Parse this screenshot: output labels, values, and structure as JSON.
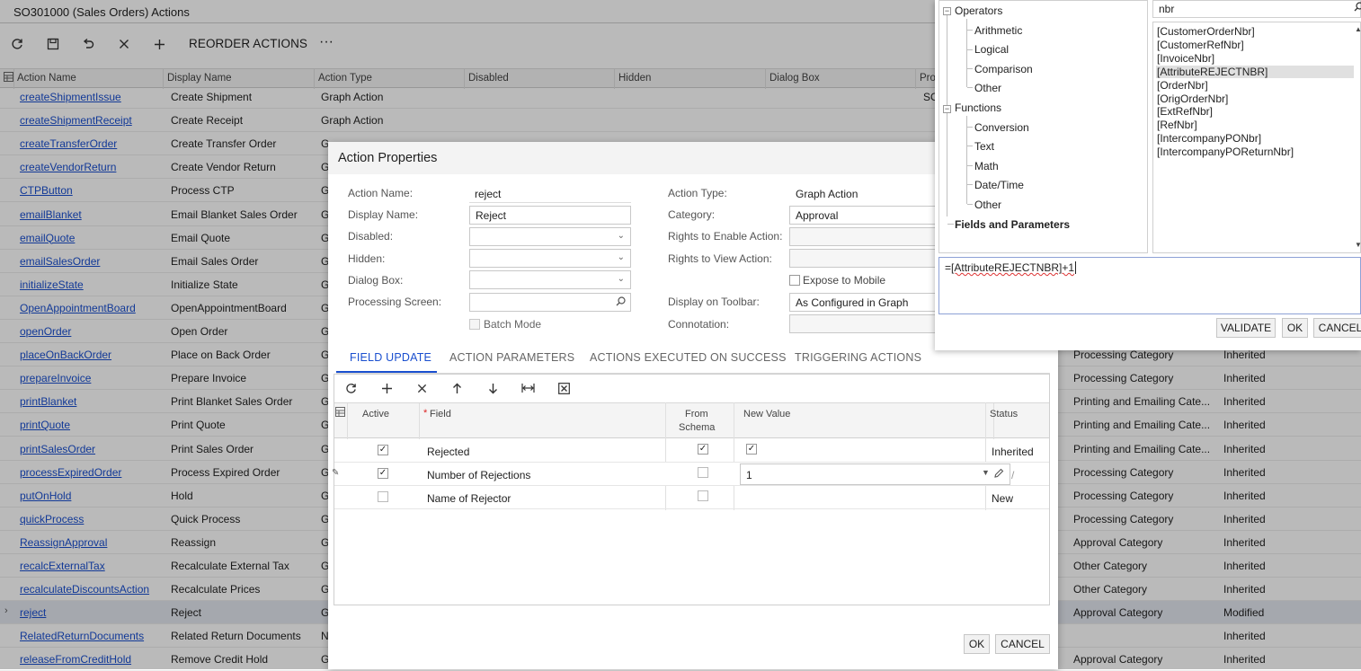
{
  "page": {
    "title": "SO301000 (Sales Orders) Actions",
    "toolbar": {
      "reorder_label": "REORDER ACTIONS",
      "more_label": "···"
    }
  },
  "grid": {
    "columns": [
      "Action Name",
      "Display Name",
      "Action Type",
      "Disabled",
      "Hidden",
      "Dialog Box",
      "Pro"
    ],
    "rows": [
      {
        "name": "createShipmentIssue",
        "display": "Create Shipment",
        "type": "Graph Action",
        "category": "",
        "status": ""
      },
      {
        "name": "createShipmentReceipt",
        "display": "Create Receipt",
        "type": "Graph Action",
        "category": "",
        "status": ""
      },
      {
        "name": "createTransferOrder",
        "display": "Create Transfer Order",
        "type": "G",
        "category": "",
        "status": ""
      },
      {
        "name": "createVendorReturn",
        "display": "Create Vendor Return",
        "type": "G",
        "category": "",
        "status": ""
      },
      {
        "name": "CTPButton",
        "display": "Process CTP",
        "type": "G",
        "category": "",
        "status": ""
      },
      {
        "name": "emailBlanket",
        "display": "Email Blanket Sales Order",
        "type": "G",
        "category": "",
        "status": ""
      },
      {
        "name": "emailQuote",
        "display": "Email Quote",
        "type": "G",
        "category": "",
        "status": ""
      },
      {
        "name": "emailSalesOrder",
        "display": "Email Sales Order",
        "type": "G",
        "category": "",
        "status": ""
      },
      {
        "name": "initializeState",
        "display": "Initialize State",
        "type": "G",
        "category": "",
        "status": ""
      },
      {
        "name": "OpenAppointmentBoard",
        "display": "OpenAppointmentBoard",
        "type": "G",
        "category": "",
        "status": ""
      },
      {
        "name": "openOrder",
        "display": "Open Order",
        "type": "G",
        "category": "",
        "status": ""
      },
      {
        "name": "placeOnBackOrder",
        "display": "Place on Back Order",
        "type": "G",
        "category": "Processing Category",
        "status": "Inherited"
      },
      {
        "name": "prepareInvoice",
        "display": "Prepare Invoice",
        "type": "G",
        "category": "Processing Category",
        "status": "Inherited"
      },
      {
        "name": "printBlanket",
        "display": "Print Blanket Sales Order",
        "type": "G",
        "category": "Printing and Emailing Cate...",
        "status": "Inherited"
      },
      {
        "name": "printQuote",
        "display": "Print Quote",
        "type": "G",
        "category": "Printing and Emailing Cate...",
        "status": "Inherited"
      },
      {
        "name": "printSalesOrder",
        "display": "Print Sales Order",
        "type": "G",
        "category": "Printing and Emailing Cate...",
        "status": "Inherited"
      },
      {
        "name": "processExpiredOrder",
        "display": "Process Expired Order",
        "type": "G",
        "category": "Processing Category",
        "status": "Inherited"
      },
      {
        "name": "putOnHold",
        "display": "Hold",
        "type": "G",
        "category": "Processing Category",
        "status": "Inherited"
      },
      {
        "name": "quickProcess",
        "display": "Quick Process",
        "type": "G",
        "category": "Processing Category",
        "status": "Inherited"
      },
      {
        "name": "ReassignApproval",
        "display": "Reassign",
        "type": "G",
        "category": "Approval Category",
        "status": "Inherited"
      },
      {
        "name": "recalcExternalTax",
        "display": "Recalculate External Tax",
        "type": "G",
        "category": "Other Category",
        "status": "Inherited"
      },
      {
        "name": "recalculateDiscountsAction",
        "display": "Recalculate Prices",
        "type": "G",
        "category": "Other Category",
        "status": "Inherited"
      },
      {
        "name": "reject",
        "display": "Reject",
        "type": "G",
        "category": "Approval Category",
        "status": "Modified"
      },
      {
        "name": "RelatedReturnDocuments",
        "display": "Related Return Documents",
        "type": "N",
        "category": "",
        "status": "Inherited"
      },
      {
        "name": "releaseFromCreditHold",
        "display": "Remove Credit Hold",
        "type": "G",
        "category": "Approval Category",
        "status": "Inherited"
      }
    ],
    "pro_cell_fragment": "SO"
  },
  "dialog": {
    "title": "Action Properties",
    "action_name_label": "Action Name:",
    "action_name": "reject",
    "display_name_label": "Display Name:",
    "display_name": "Reject",
    "disabled_label": "Disabled:",
    "hidden_label": "Hidden:",
    "dialog_box_label": "Dialog Box:",
    "processing_screen_label": "Processing Screen:",
    "batch_mode_label": "Batch Mode",
    "action_type_label": "Action Type:",
    "action_type": "Graph Action",
    "category_label": "Category:",
    "category": "Approval",
    "rights_enable_label": "Rights to Enable Action:",
    "rights_view_label": "Rights to View Action:",
    "expose_mobile_label": "Expose to Mobile",
    "display_toolbar_label": "Display on Toolbar:",
    "display_toolbar": "As Configured in Graph",
    "connotation_label": "Connotation:",
    "tabs": [
      "FIELD UPDATE",
      "ACTION PARAMETERS",
      "ACTIONS EXECUTED ON SUCCESS",
      "TRIGGERING ACTIONS"
    ],
    "field_grid": {
      "col_active": "Active",
      "col_field_marker": "*",
      "col_field": "Field",
      "col_from_schema_1": "From",
      "col_from_schema_2": "Schema",
      "col_new_value": "New Value",
      "col_status": "Status",
      "rows": [
        {
          "active": true,
          "field": "Rejected",
          "from_schema": true,
          "new_value_checkbox": true,
          "status": "Inherited"
        },
        {
          "active": true,
          "field": "Number of Rejections",
          "from_schema": false,
          "new_value": "1",
          "status": "/"
        },
        {
          "active": false,
          "field": "Name of Rejector",
          "from_schema": false,
          "new_value": "",
          "status": "New"
        }
      ]
    },
    "ok_label": "OK",
    "cancel_label": "CANCEL"
  },
  "formula_editor": {
    "tree": {
      "operators": "Operators",
      "op_children": [
        "Arithmetic",
        "Logical",
        "Comparison",
        "Other"
      ],
      "functions": "Functions",
      "fn_children": [
        "Conversion",
        "Text",
        "Math",
        "Date/Time",
        "Other"
      ],
      "fields": "Fields and Parameters"
    },
    "search_value": "nbr",
    "fields": [
      "[CustomerOrderNbr]",
      "[CustomerRefNbr]",
      "[InvoiceNbr]",
      "[AttributeREJECTNBR]",
      "[OrderNbr]",
      "[OrigOrderNbr]",
      "[ExtRefNbr]",
      "[RefNbr]",
      "[IntercompanyPONbr]",
      "[IntercompanyPOReturnNbr]"
    ],
    "selected_field": "[AttributeREJECTNBR]",
    "expression_prefix": "=",
    "expression": "[AttributeREJECTNBR]+1",
    "validate_label": "VALIDATE",
    "ok_label": "OK",
    "cancel_label": "CANCEL"
  }
}
